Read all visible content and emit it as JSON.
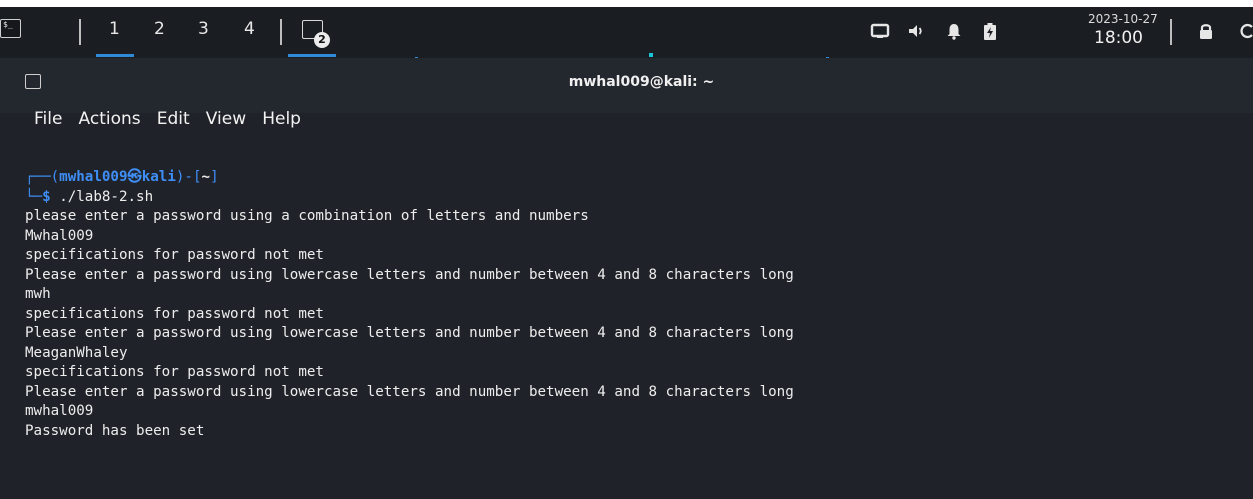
{
  "panel": {
    "workspaces": [
      "1",
      "2",
      "3",
      "4"
    ],
    "task_badge": "2",
    "clock": {
      "date": "2023-10-27",
      "time": "18:00"
    },
    "icons": [
      "terminal-icon",
      "display-icon",
      "volume-icon",
      "bell-icon",
      "battery-icon",
      "lock-icon"
    ]
  },
  "window": {
    "title": "mwhal009@kali: ~",
    "menu": [
      "File",
      "Actions",
      "Edit",
      "View",
      "Help"
    ]
  },
  "terminal": {
    "prompt": {
      "user": "mwhal009",
      "host": "kali",
      "dir": "~",
      "symbol": "$",
      "command": "./lab8-2.sh"
    },
    "output": [
      "please enter a password using a combination of letters and numbers",
      "Mwhal009",
      "specifications for password not met",
      "Please enter a password using lowercase letters and number between 4 and 8 characters long",
      "mwh",
      "specifications for password not met",
      "Please enter a password using lowercase letters and number between 4 and 8 characters long",
      "MeaganWhaley",
      "specifications for password not met",
      "Please enter a password using lowercase letters and number between 4 and 8 characters long",
      "mwhal009",
      "Password has been set"
    ]
  },
  "colors": {
    "accent": "#2f8bd8",
    "prompt": "#3f8ef6",
    "terminal_bg": "#1f2329",
    "panel_bg": "#1a1d22"
  }
}
